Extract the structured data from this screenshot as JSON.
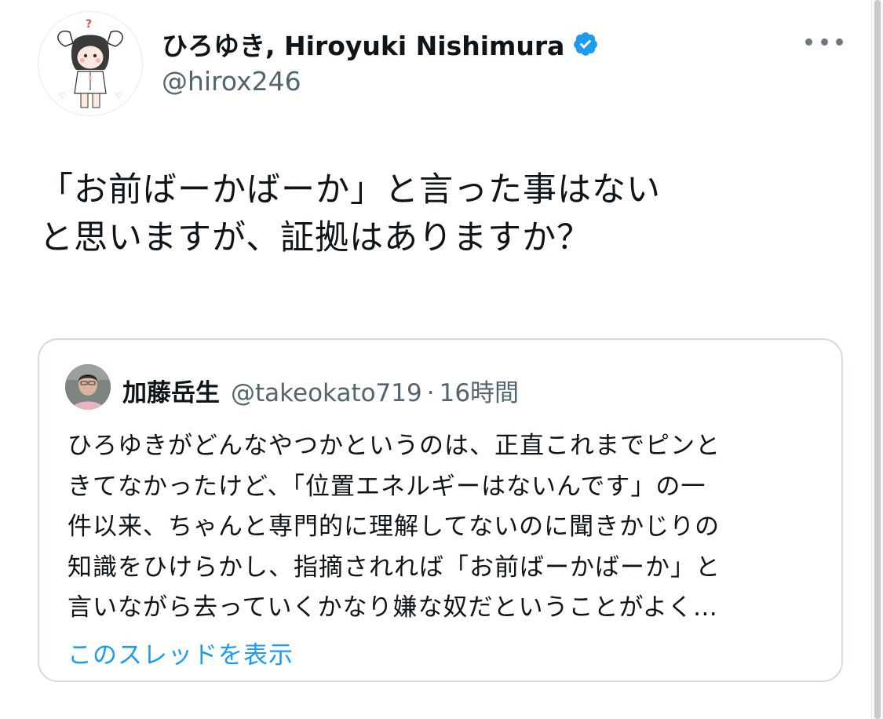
{
  "tweet": {
    "author": {
      "display_name": "ひろゆき, Hiroyuki Nishimura",
      "handle": "@hirox246",
      "verified": true,
      "avatar": "hirox246-avatar"
    },
    "text": "「お前ばーかばーか」と言った事はない\nと思いますが、証拠はありますか？",
    "more_icon": "more-horizontal-icon"
  },
  "quoted_tweet": {
    "author": {
      "display_name": "加藤岳生",
      "handle": "@takeokato719",
      "separator": "·",
      "time": "16時間",
      "avatar": "takeokato719-avatar"
    },
    "text": "ひろゆきがどんなやつかというのは、正直これまでピンと\nきてなかったけど、「位置エネルギーはないんです」の一\n件以来、ちゃんと専門的に理解してないのに聞きかじりの\n知識をひけらかし、指摘されれば「お前ばーかばーか」と\n言いながら去っていくかなり嫌な奴だということがよく…",
    "show_thread_label": "このスレッドを表示"
  },
  "colors": {
    "text_primary": "#0f1419",
    "text_secondary": "#536471",
    "link": "#1d9bf0",
    "verified_badge": "#1d9bf0",
    "card_border": "#d4dadf"
  }
}
